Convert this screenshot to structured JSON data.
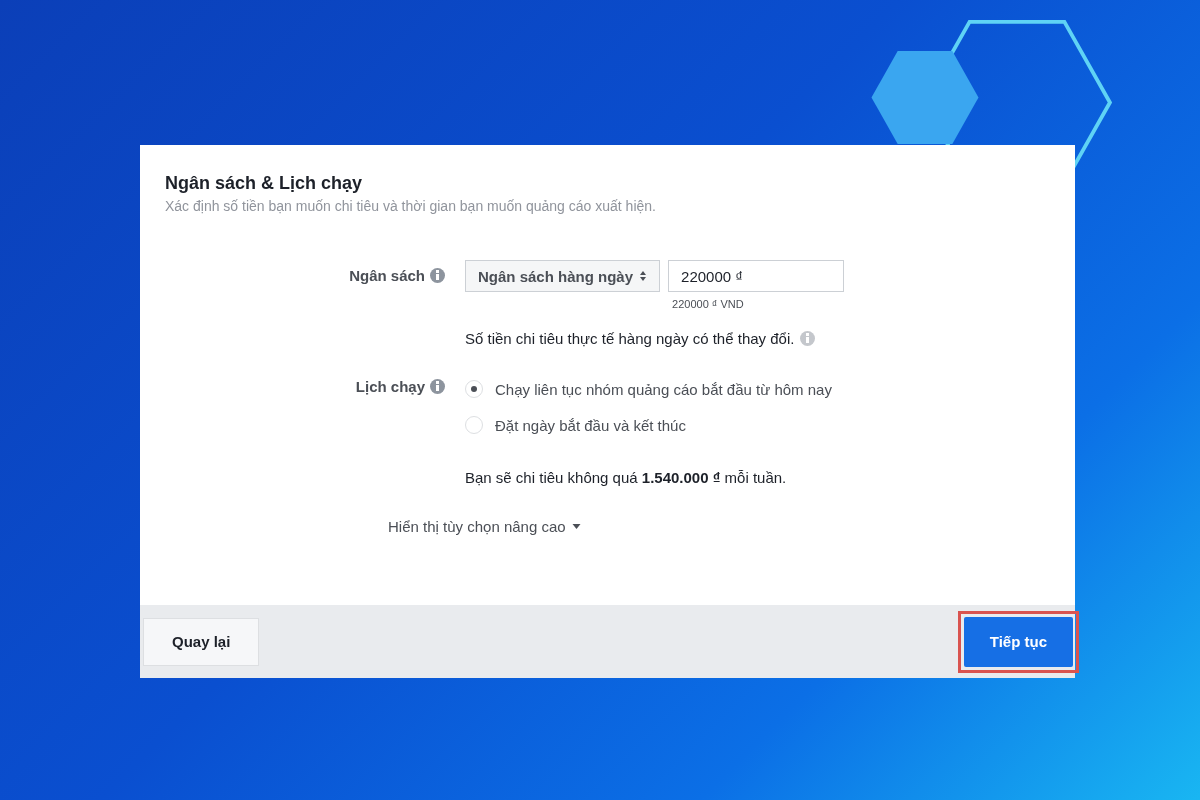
{
  "dialog": {
    "title": "Ngân sách & Lịch chạy",
    "subtitle": "Xác định số tiền bạn muốn chi tiêu và thời gian bạn muốn quảng cáo xuất hiện.",
    "budget": {
      "label": "Ngân sách",
      "type_select": "Ngân sách hàng ngày",
      "amount": "220000 ₫",
      "amount_hint": "220000 ₫ VND",
      "note": "Số tiền chi tiêu thực tế hàng ngày có thể thay đổi."
    },
    "schedule": {
      "label": "Lịch chạy",
      "options": [
        {
          "label": "Chạy liên tục nhóm quảng cáo bắt đầu từ hôm nay",
          "selected": true
        },
        {
          "label": "Đặt ngày bắt đầu và kết thúc",
          "selected": false
        }
      ]
    },
    "summary": "Bạn sẽ chi tiêu không quá **1.540.000 ₫** mỗi tuần.",
    "advanced_link": "Hiển thị tùy chọn nâng cao",
    "footer": {
      "back": "Quay lại",
      "continue": "Tiếp tục",
      "continue_highlighted": true
    }
  }
}
